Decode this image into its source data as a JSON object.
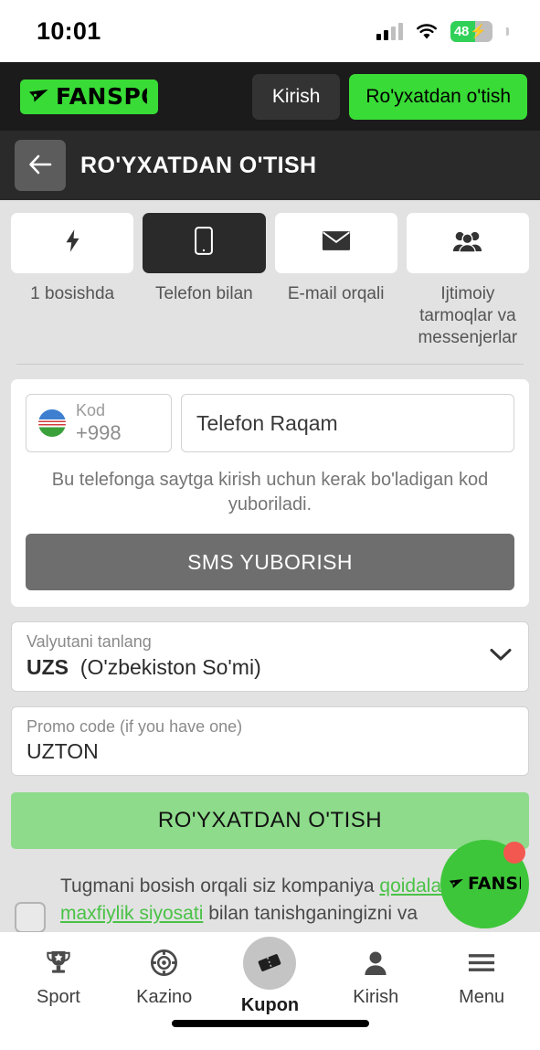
{
  "status_bar": {
    "time": "10:01",
    "battery_percent": "48",
    "battery_charging_icon": "bolt-icon",
    "wifi_icon": "wifi-icon",
    "signal_icon": "cellular-signal-icon"
  },
  "top_bar": {
    "logo_text": "FANSPORT",
    "logo_mark_icon": "paper-plane-icon",
    "login_label": "Kirish",
    "register_label": "Ro'yxatdan o'tish"
  },
  "page_header": {
    "back_icon": "arrow-left-icon",
    "title": "RO'YXATDAN O'TISH"
  },
  "methods": [
    {
      "icon": "lightning-bolt-icon",
      "label": "1 bosishda",
      "active": false
    },
    {
      "icon": "mobile-phone-icon",
      "label": "Telefon bilan",
      "active": true
    },
    {
      "icon": "envelope-icon",
      "label": "E-mail orqali",
      "active": false
    },
    {
      "icon": "group-people-icon",
      "label": "Ijtimoiy tarmoqlar va messenjerlar",
      "active": false
    }
  ],
  "phone_form": {
    "country_flag_icon": "uzbekistan-flag-icon",
    "code_label": "Kod",
    "code_value": "+998",
    "phone_placeholder": "Telefon Raqam",
    "phone_value": "",
    "hint": "Bu telefonga saytga kirish uchun kerak bo'ladigan kod yuboriladi.",
    "sms_button_label": "SMS YUBORISH"
  },
  "currency": {
    "label": "Valyutani tanlang",
    "code": "UZS",
    "name": "(O'zbekiston So'mi)",
    "chevron_icon": "chevron-down-icon"
  },
  "promo": {
    "label": "Promo code (if you have one)",
    "value": "UZTON"
  },
  "register_button": {
    "label": "RO'YXATDAN O'TISH"
  },
  "terms": {
    "text_part1": "Tugmani bosish orqali siz kompaniya ",
    "link1": "qoidalari",
    "text_part2": " ",
    "link2": "maxfiylik siyosati",
    "text_part3": " bilan tanishganingizni va roziligingizni tasdiqlaysiz, shuningdek, qonuniy yoshga",
    "checkbox_checked": false
  },
  "fab": {
    "logo_text": "FANSPORT",
    "logo_mark_icon": "paper-plane-icon",
    "badge_icon": "notification-dot"
  },
  "bottom_nav": [
    {
      "icon": "trophy-icon",
      "label": "Sport",
      "active": false
    },
    {
      "icon": "casino-chip-icon",
      "label": "Kazino",
      "active": false
    },
    {
      "icon": "ticket-icon",
      "label": "Kupon",
      "active": true
    },
    {
      "icon": "person-icon",
      "label": "Kirish",
      "active": false
    },
    {
      "icon": "hamburger-menu-icon",
      "label": "Menu",
      "active": false
    }
  ],
  "colors": {
    "brand_green": "#39db36",
    "muted_green": "#8edb8b",
    "link_green": "#49c246",
    "dark_header": "#2a2a2a",
    "top_bar": "#1b1b1b",
    "page_bg": "#e2e2e2",
    "disabled_gray": "#6e6e6e",
    "badge_red": "#f2584f"
  }
}
